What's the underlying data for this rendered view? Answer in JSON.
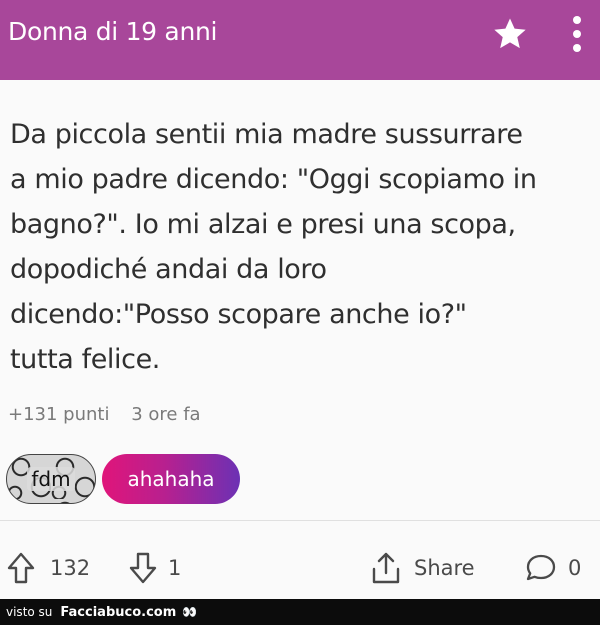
{
  "header": {
    "title": "Donna di 19 anni",
    "star_icon": "star-icon",
    "menu_icon": "more-vertical-icon",
    "color": "#a8479a"
  },
  "post": {
    "lines": [
      "Da piccola sentii mia madre sussurrare",
      "a mio padre dicendo: \"Oggi scopiamo in",
      "bagno?\". Io mi alzai e presi una scopa,",
      "dopodiché andai da loro",
      "dicendo:\"Posso scopare anche io?\"",
      "tutta felice."
    ],
    "points": "+131 punti",
    "time": "3 ore fa"
  },
  "tags": [
    {
      "label": "fdm"
    },
    {
      "label": "ahahaha"
    }
  ],
  "actions": {
    "upvotes": "132",
    "downvotes": "1",
    "share_label": "Share",
    "comments": "0"
  },
  "footer": {
    "visto_su": "visto su",
    "site": "Facciabuco.com",
    "eyes": "👀"
  }
}
